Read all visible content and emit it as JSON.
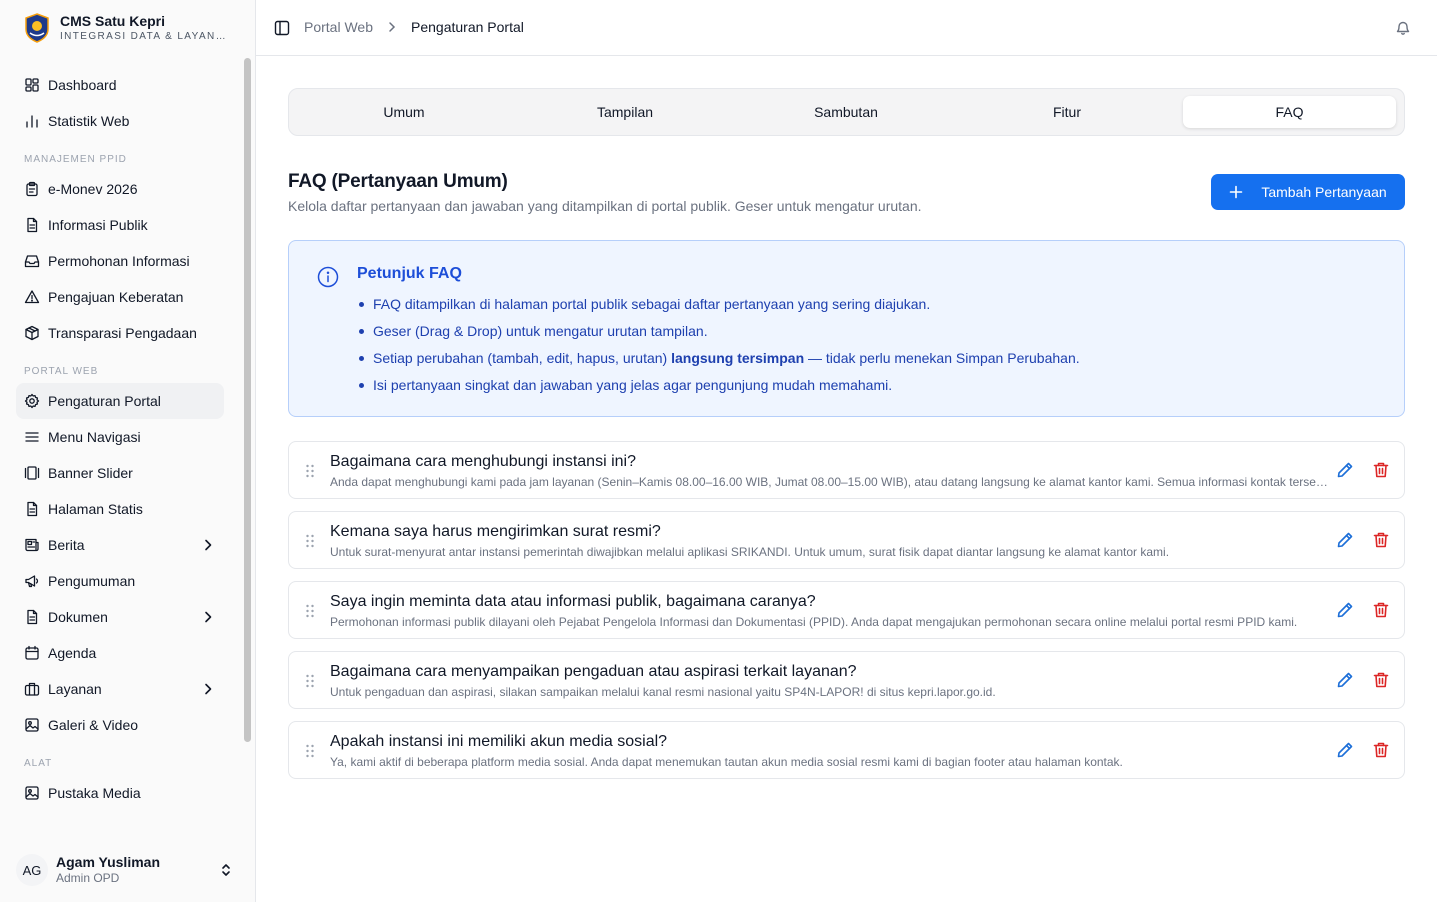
{
  "brand": {
    "title": "CMS Satu Kepri",
    "subtitle": "INTEGRASI DATA & LAYANAN"
  },
  "sidebar": {
    "groups": [
      {
        "label": "",
        "items": [
          {
            "label": "Dashboard",
            "icon": "dashboard-icon"
          },
          {
            "label": "Statistik Web",
            "icon": "chart-bar-icon"
          }
        ]
      },
      {
        "label": "MANAJEMEN PPID",
        "items": [
          {
            "label": "e-Monev 2026",
            "icon": "clipboard-icon"
          },
          {
            "label": "Informasi Publik",
            "icon": "document-icon"
          },
          {
            "label": "Permohonan Informasi",
            "icon": "inbox-icon"
          },
          {
            "label": "Pengajuan Keberatan",
            "icon": "warning-icon"
          },
          {
            "label": "Transparasi Pengadaan",
            "icon": "package-icon"
          }
        ]
      },
      {
        "label": "PORTAL WEB",
        "items": [
          {
            "label": "Pengaturan Portal",
            "icon": "gear-icon",
            "active": true
          },
          {
            "label": "Menu Navigasi",
            "icon": "menu-icon"
          },
          {
            "label": "Banner Slider",
            "icon": "gallery-icon"
          },
          {
            "label": "Halaman Statis",
            "icon": "document-icon"
          },
          {
            "label": "Berita",
            "icon": "newspaper-icon",
            "expandable": true
          },
          {
            "label": "Pengumuman",
            "icon": "megaphone-icon"
          },
          {
            "label": "Dokumen",
            "icon": "document-icon",
            "expandable": true
          },
          {
            "label": "Agenda",
            "icon": "calendar-icon"
          },
          {
            "label": "Layanan",
            "icon": "briefcase-icon",
            "expandable": true
          },
          {
            "label": "Galeri & Video",
            "icon": "image-icon"
          }
        ]
      },
      {
        "label": "ALAT",
        "items": [
          {
            "label": "Pustaka Media",
            "icon": "image-icon"
          }
        ]
      }
    ]
  },
  "user": {
    "initials": "AG",
    "name": "Agam Yusliman",
    "role": "Admin OPD"
  },
  "header": {
    "breadcrumb_parent": "Portal Web",
    "breadcrumb_current": "Pengaturan Portal"
  },
  "tabs": [
    {
      "label": "Umum"
    },
    {
      "label": "Tampilan"
    },
    {
      "label": "Sambutan"
    },
    {
      "label": "Fitur"
    },
    {
      "label": "FAQ",
      "active": true
    }
  ],
  "section": {
    "title": "FAQ (Pertanyaan Umum)",
    "description": "Kelola daftar pertanyaan dan jawaban yang ditampilkan di portal publik. Geser untuk mengatur urutan.",
    "add_button": "Tambah Pertanyaan"
  },
  "info": {
    "title": "Petunjuk FAQ",
    "items": [
      "FAQ ditampilkan di halaman portal publik sebagai daftar pertanyaan yang sering diajukan.",
      "Geser (Drag & Drop) untuk mengatur urutan tampilan."
    ],
    "item3_before": "Setiap perubahan (tambah, edit, hapus, urutan) ",
    "item3_bold": "langsung tersimpan",
    "item3_after": " — tidak perlu menekan Simpan Perubahan.",
    "item4": "Isi pertanyaan singkat dan jawaban yang jelas agar pengunjung mudah memahami."
  },
  "faqs": [
    {
      "question": "Bagaimana cara menghubungi instansi ini?",
      "answer": "Anda dapat menghubungi kami pada jam layanan (Senin–Kamis 08.00–16.00 WIB, Jumat 08.00–15.00 WIB), atau datang langsung ke alamat kantor kami. Semua informasi kontak tersedia di halaman kontak."
    },
    {
      "question": "Kemana saya harus mengirimkan surat resmi?",
      "answer": "Untuk surat-menyurat antar instansi pemerintah diwajibkan melalui aplikasi SRIKANDI. Untuk umum, surat fisik dapat diantar langsung ke alamat kantor kami."
    },
    {
      "question": "Saya ingin meminta data atau informasi publik, bagaimana caranya?",
      "answer": "Permohonan informasi publik dilayani oleh Pejabat Pengelola Informasi dan Dokumentasi (PPID). Anda dapat mengajukan permohonan secara online melalui portal resmi PPID kami."
    },
    {
      "question": "Bagaimana cara menyampaikan pengaduan atau aspirasi terkait layanan?",
      "answer": "Untuk pengaduan dan aspirasi, silakan sampaikan melalui kanal resmi nasional yaitu SP4N-LAPOR! di situs kepri.lapor.go.id."
    },
    {
      "question": "Apakah instansi ini memiliki akun media sosial?",
      "answer": "Ya, kami aktif di beberapa platform media sosial. Anda dapat menemukan tautan akun media sosial resmi kami di bagian footer atau halaman kontak."
    }
  ],
  "colors": {
    "primary": "#1570ef",
    "edit": "#1d6fd8",
    "delete": "#dc2626",
    "info_bg": "#eff5ff",
    "info_text": "#1e40af"
  }
}
